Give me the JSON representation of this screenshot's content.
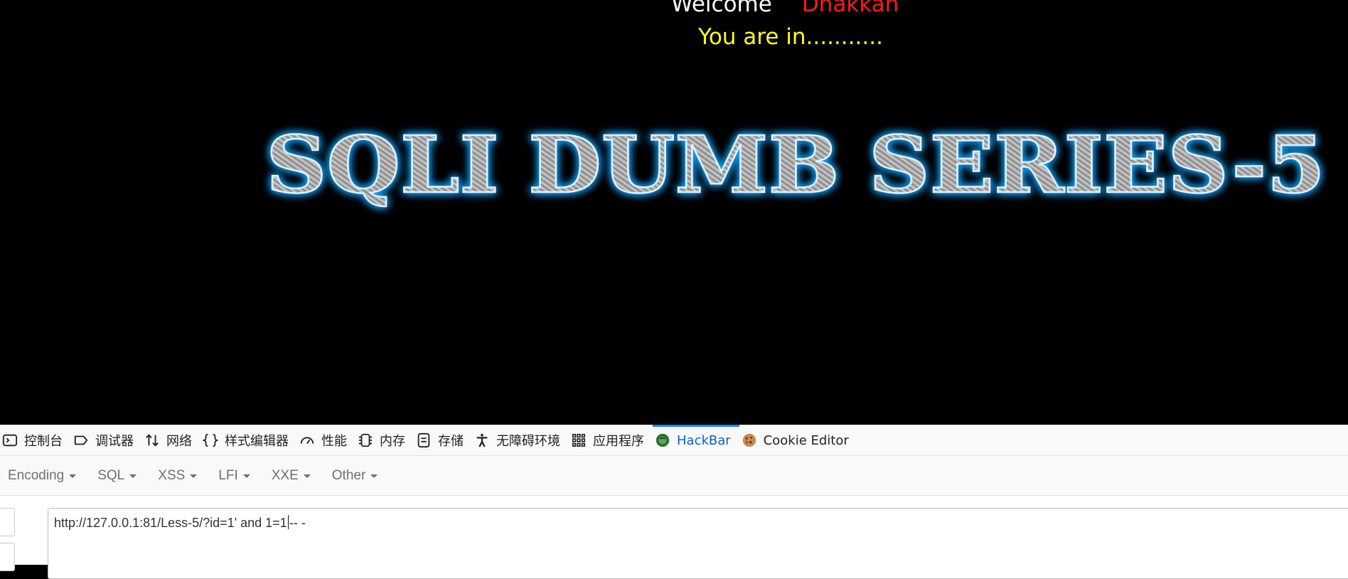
{
  "page": {
    "welcome_label": "Welcome",
    "user_name": "Dhakkan",
    "status_text": "You are in...........",
    "banner_text": "SQLI DUMB SERIES-5"
  },
  "devtools": {
    "tabs": [
      {
        "label": "控制台",
        "icon": "console-icon"
      },
      {
        "label": "调试器",
        "icon": "debugger-icon"
      },
      {
        "label": "网络",
        "icon": "network-icon"
      },
      {
        "label": "样式编辑器",
        "icon": "style-editor-icon"
      },
      {
        "label": "性能",
        "icon": "performance-icon"
      },
      {
        "label": "内存",
        "icon": "memory-icon"
      },
      {
        "label": "存储",
        "icon": "storage-icon"
      },
      {
        "label": "无障碍环境",
        "icon": "accessibility-icon"
      },
      {
        "label": "应用程序",
        "icon": "application-icon"
      },
      {
        "label": "HackBar",
        "icon": "hackbar-icon",
        "active": true
      },
      {
        "label": "Cookie Editor",
        "icon": "cookie-icon"
      }
    ]
  },
  "hackbar": {
    "menu": [
      "Encoding",
      "SQL",
      "XSS",
      "LFI",
      "XXE",
      "Other"
    ],
    "url_before_cursor": "http://127.0.0.1:81/Less-5/?id=1' and 1=1",
    "url_after_cursor": "-- -"
  },
  "colors": {
    "welcome": "#ffffff",
    "user_name": "#ff1a1a",
    "status": "#ffff1a",
    "banner_glow": "#1aa3ff",
    "active_tab": "#0a60d0"
  }
}
